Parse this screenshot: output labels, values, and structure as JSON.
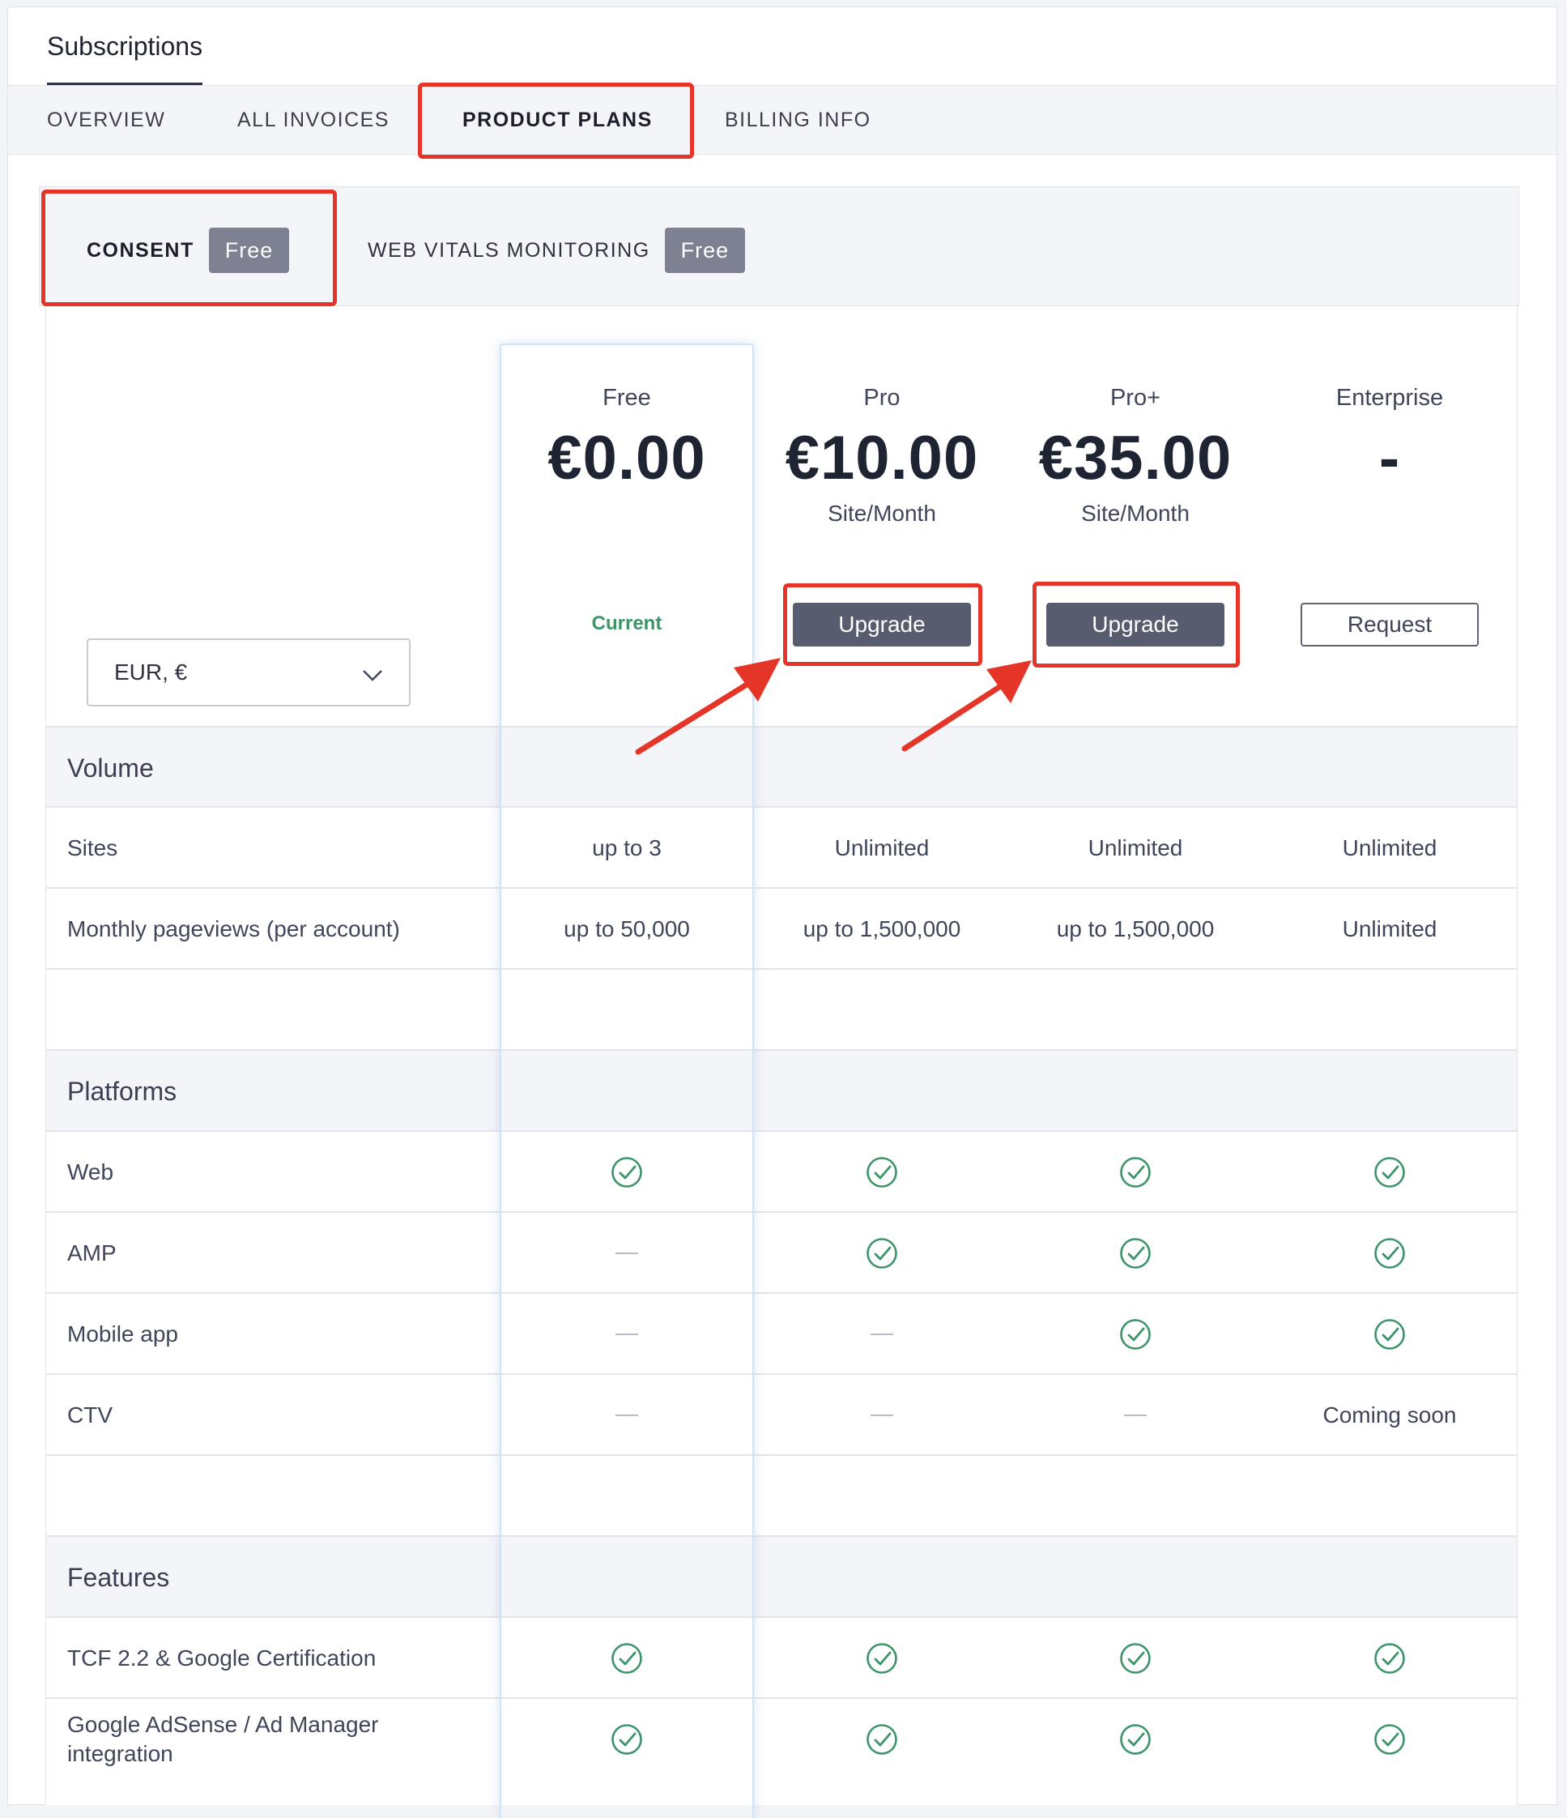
{
  "page": {
    "title": "Subscriptions"
  },
  "main_tabs": [
    {
      "label": "OVERVIEW"
    },
    {
      "label": "ALL INVOICES"
    },
    {
      "label": "PRODUCT PLANS"
    },
    {
      "label": "BILLING INFO"
    }
  ],
  "sub_tabs": [
    {
      "label": "CONSENT",
      "badge": "Free"
    },
    {
      "label": "WEB VITALS MONITORING",
      "badge": "Free"
    }
  ],
  "currency": {
    "value": "EUR, €"
  },
  "plans": [
    {
      "name": "Free",
      "price": "€0.00",
      "unit": "",
      "status": "Current"
    },
    {
      "name": "Pro",
      "price": "€10.00",
      "unit": "Site/Month",
      "action": "Upgrade"
    },
    {
      "name": "Pro+",
      "price": "€35.00",
      "unit": "Site/Month",
      "action": "Upgrade"
    },
    {
      "name": "Enterprise",
      "price": "-",
      "unit": "",
      "action": "Request"
    }
  ],
  "sections": {
    "volume": "Volume",
    "platforms": "Platforms",
    "features": "Features"
  },
  "rows": {
    "sites": {
      "label": "Sites",
      "values": [
        "up to 3",
        "Unlimited",
        "Unlimited",
        "Unlimited"
      ]
    },
    "pageviews": {
      "label": "Monthly pageviews (per account)",
      "values": [
        "up to 50,000",
        "up to 1,500,000",
        "up to 1,500,000",
        "Unlimited"
      ]
    },
    "web": {
      "label": "Web"
    },
    "amp": {
      "label": "AMP"
    },
    "mobile": {
      "label": "Mobile app"
    },
    "ctv": {
      "label": "CTV",
      "enterprise_value": "Coming soon"
    },
    "tcf": {
      "label": "TCF 2.2 & Google Certification"
    },
    "adsense": {
      "label": "Google AdSense / Ad Manager integration"
    }
  },
  "colors": {
    "accent_dark": "#585c6f",
    "check_green": "#3c9468",
    "highlight_red": "#e53528"
  }
}
